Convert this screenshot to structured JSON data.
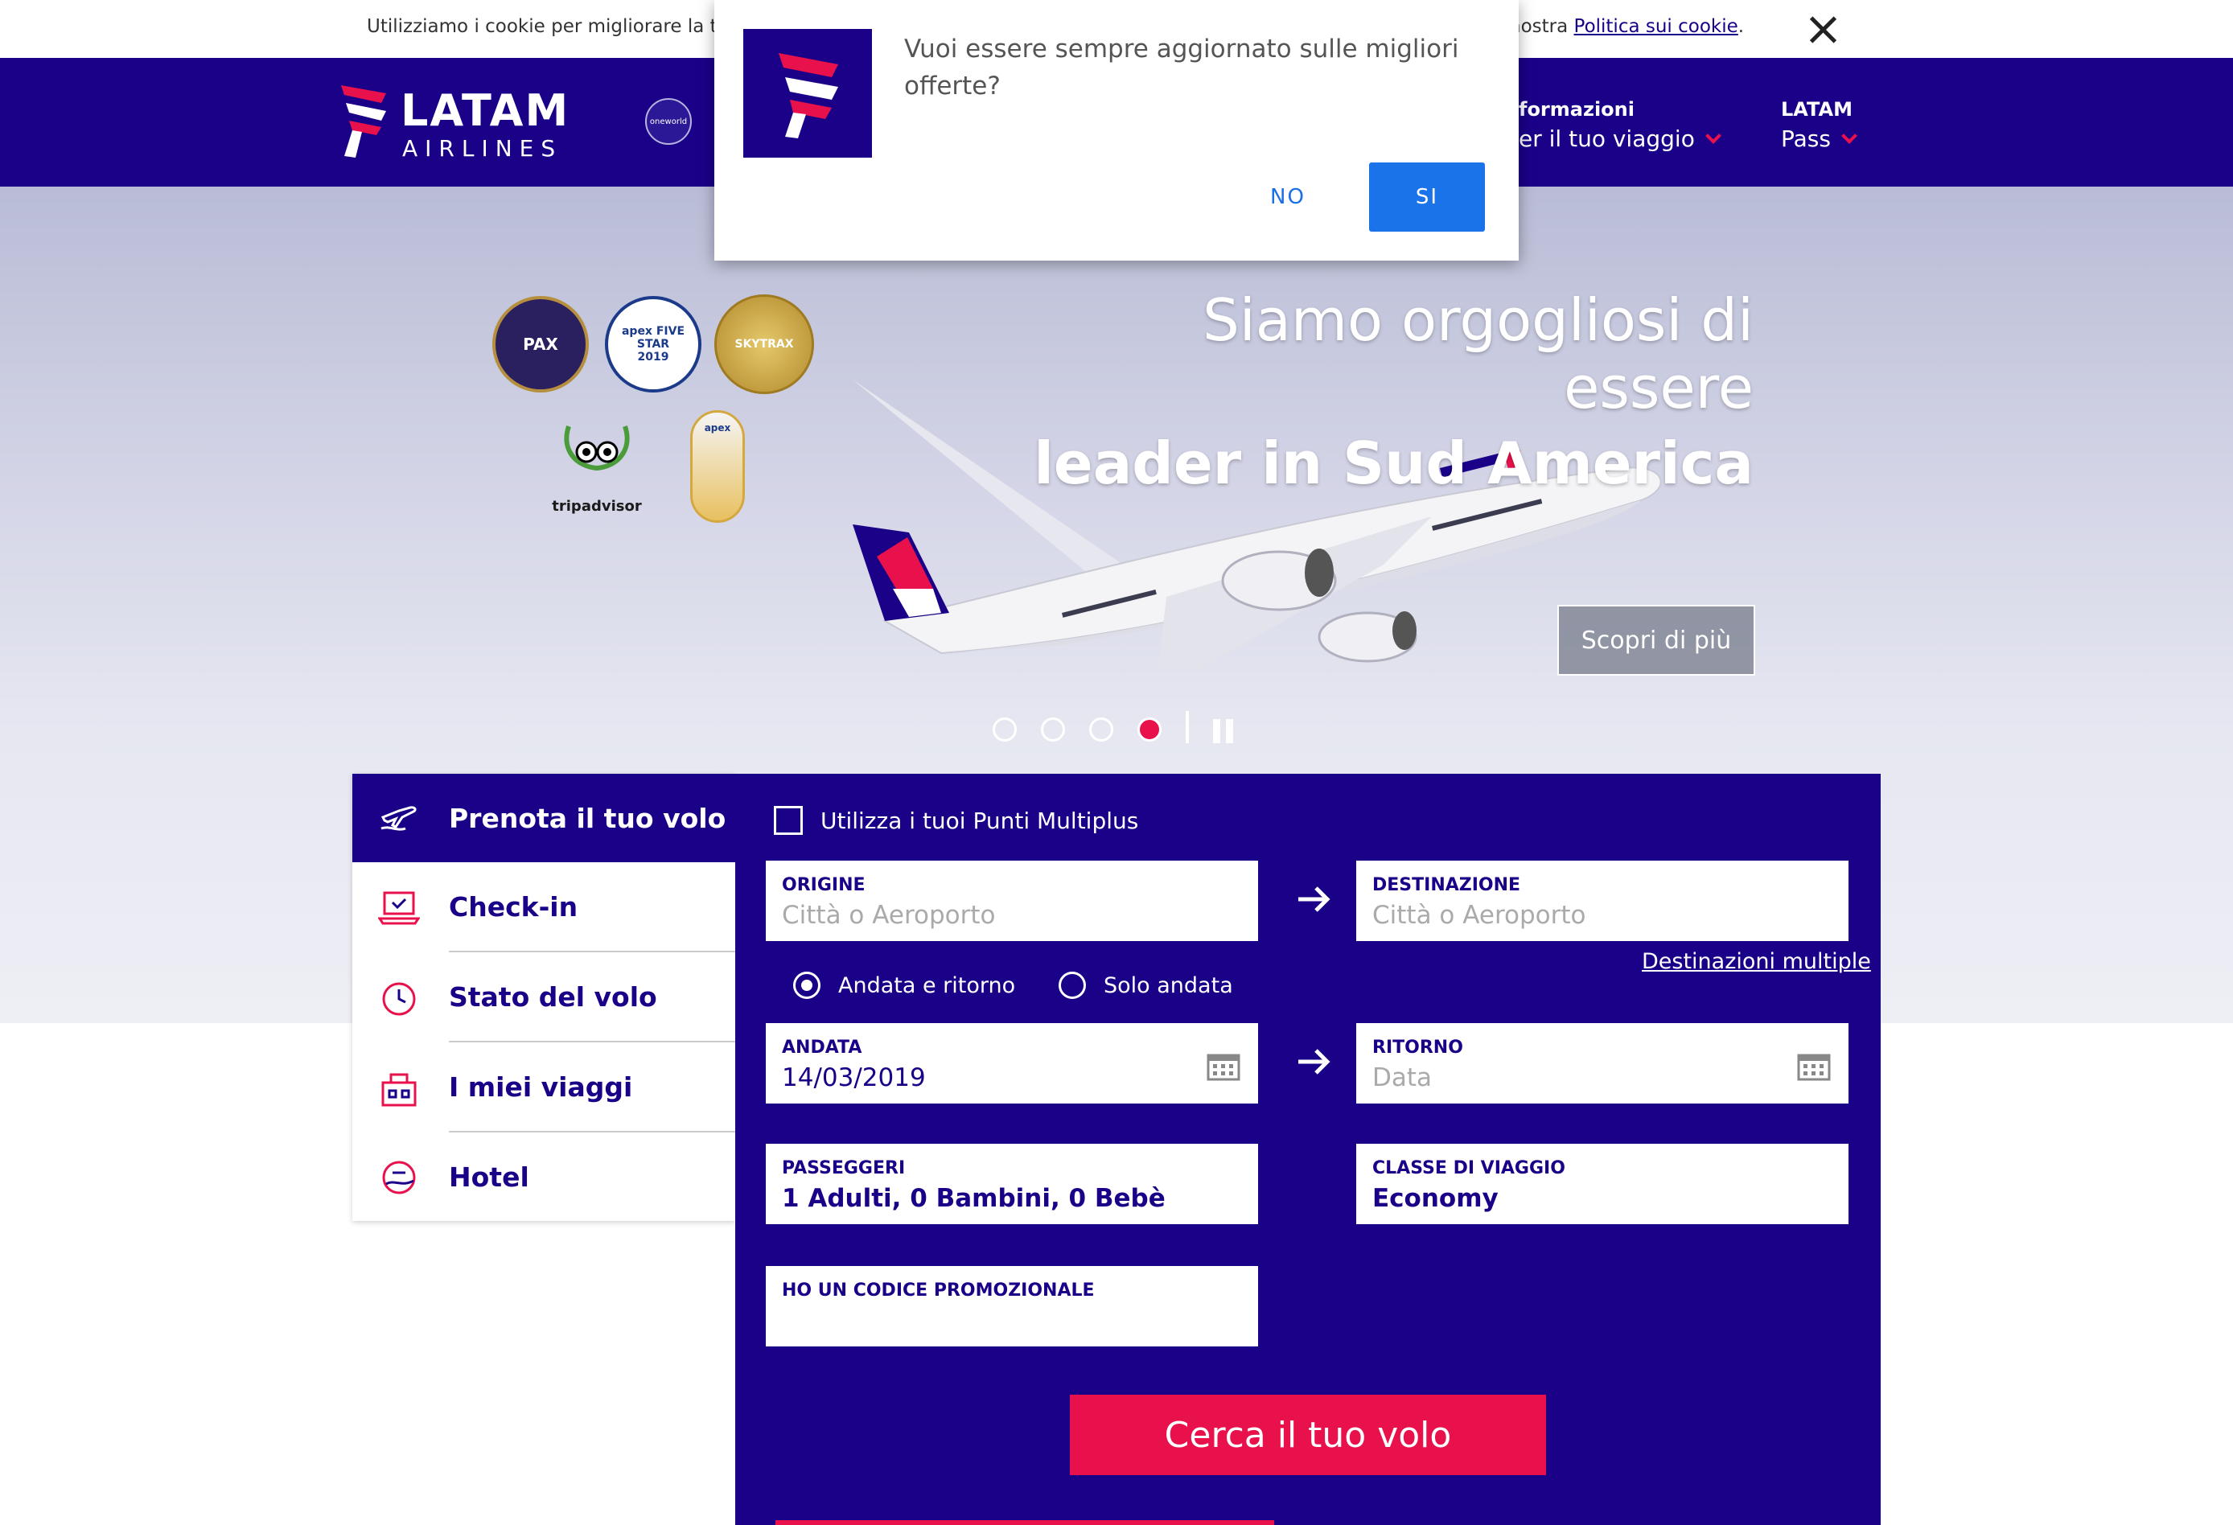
{
  "cookie_bar": {
    "text_left": "Utilizziamo i cookie per migliorare la tua e",
    "text_right": "nostra",
    "policy_link": "Politica sui cookie",
    "policy_end": "."
  },
  "header": {
    "logo_word": "LATAM",
    "logo_sub": "AIRLINES",
    "oneworld": "oneworld",
    "nav": [
      {
        "line1": "formazioni",
        "line2": "er il tuo viaggio"
      },
      {
        "line1": "LATAM",
        "line2": "Pass"
      }
    ]
  },
  "popup": {
    "message": "Vuoi essere sempre aggiornato sulle migliori offerte?",
    "no_label": "NO",
    "si_label": "SI"
  },
  "hero": {
    "title_line1": "Siamo orgogliosi di essere",
    "title_line2": "leader in Sud America",
    "cta_label": "Scopri di più",
    "slides_count": 4,
    "active_slide": 4,
    "badges": {
      "pax": "PAX",
      "apex": "apex FIVE STAR 2019",
      "skytrax": "SKYTRAX",
      "tripadvisor": "tripadvisor",
      "apex_choice": "apex"
    }
  },
  "booking": {
    "menu": [
      {
        "label": "Prenota il tuo volo",
        "active": true
      },
      {
        "label": "Check-in",
        "active": false
      },
      {
        "label": "Stato del volo",
        "active": false
      },
      {
        "label": "I miei viaggi",
        "active": false
      },
      {
        "label": "Hotel",
        "active": false
      }
    ],
    "multiplus_label": "Utilizza i tuoi Punti Multiplus",
    "origin": {
      "label": "ORIGINE",
      "placeholder": "Città o Aeroporto"
    },
    "destination": {
      "label": "DESTINAZIONE",
      "placeholder": "Città o Aeroporto"
    },
    "multi_destinations": "Destinazioni multiple",
    "trip_type": [
      {
        "label": "Andata e ritorno",
        "selected": true
      },
      {
        "label": "Solo andata",
        "selected": false
      }
    ],
    "departure": {
      "label": "ANDATA",
      "value": "14/03/2019"
    },
    "return": {
      "label": "RITORNO",
      "placeholder": "Data"
    },
    "passengers": {
      "label": "PASSEGGERI",
      "value": "1 Adulti, 0 Bambini, 0 Bebè"
    },
    "cabin": {
      "label": "CLASSE DI VIAGGIO",
      "value": "Economy"
    },
    "promo": {
      "label": "HO UN CODICE PROMOZIONALE",
      "value": ""
    },
    "search_label": "Cerca il tuo volo"
  },
  "colors": {
    "brand_indigo": "#1b0088",
    "brand_coral": "#e8114b",
    "popup_blue": "#1a73e8"
  }
}
